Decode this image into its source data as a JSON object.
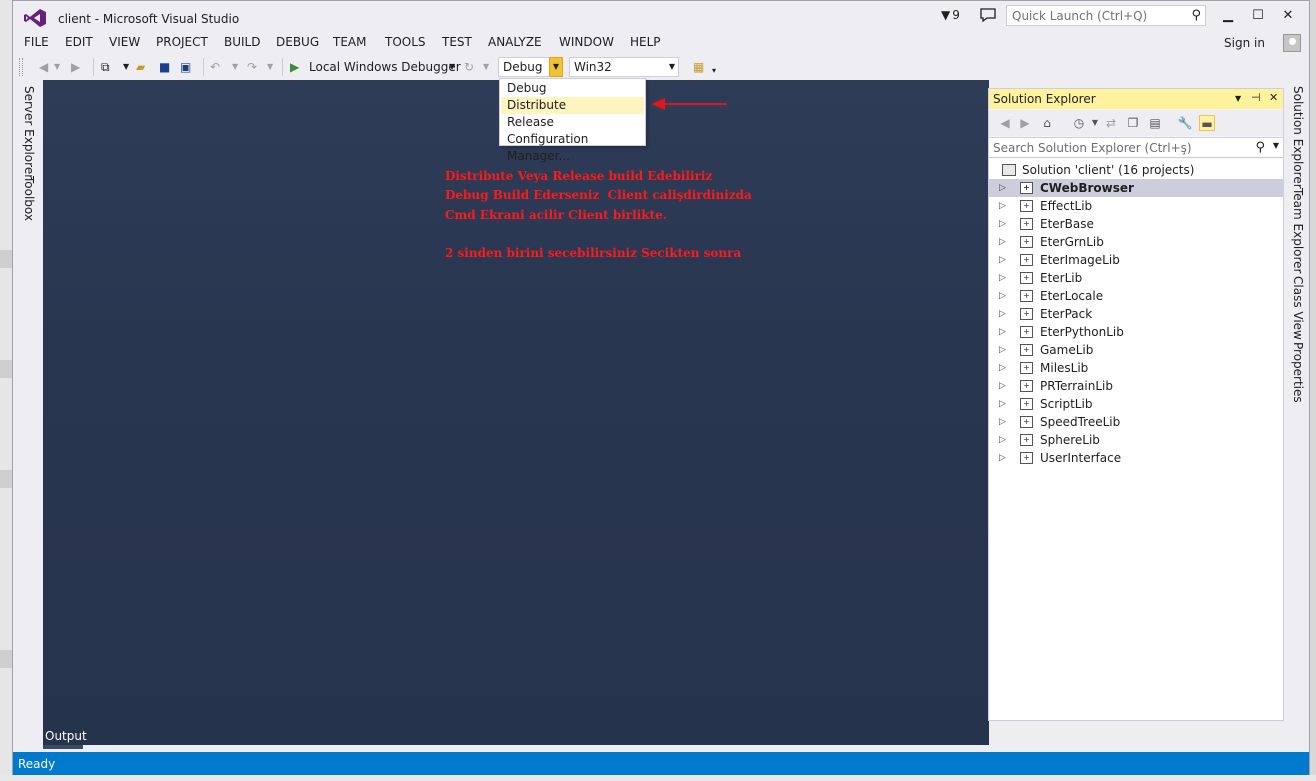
{
  "window": {
    "title": "client - Microsoft Visual Studio",
    "notification_count": "9",
    "quick_launch_placeholder": "Quick Launch (Ctrl+Q)",
    "sign_in": "Sign in"
  },
  "menu": [
    "FILE",
    "EDIT",
    "VIEW",
    "PROJECT",
    "BUILD",
    "DEBUG",
    "TEAM",
    "TOOLS",
    "TEST",
    "ANALYZE",
    "WINDOW",
    "HELP"
  ],
  "toolbar": {
    "debugger_label": "Local Windows Debugger",
    "configuration_value": "Debug",
    "platform_value": "Win32"
  },
  "config_dropdown": {
    "options": [
      "Debug",
      "Distribute",
      "Release",
      "Configuration Manager..."
    ],
    "highlighted": "Distribute"
  },
  "annotation": {
    "lines": [
      "Distribute Veya Release build Edebiliriz",
      "Debug Build Ederseniz  Client calişdirdinizda",
      "Cmd Ekrani acilir Client birlikte.",
      "",
      "2 sinden birini secebilirsiniz Secikten sonra"
    ],
    "color": "#ff1a1a"
  },
  "left_tabs": [
    "Server Explorer",
    "Toolbox"
  ],
  "right_tabs": [
    "Solution Explorer",
    "Team Explorer",
    "Class View",
    "Properties"
  ],
  "solution_explorer": {
    "title": "Solution Explorer",
    "search_placeholder": "Search Solution Explorer (Ctrl+ş)",
    "solution_label": "Solution 'client' (16 projects)",
    "projects": [
      "CWebBrowser",
      "EffectLib",
      "EterBase",
      "EterGrnLib",
      "EterImageLib",
      "EterLib",
      "EterLocale",
      "EterPack",
      "EterPythonLib",
      "GameLib",
      "MilesLib",
      "PRTerrainLib",
      "ScriptLib",
      "SpeedTreeLib",
      "SphereLib",
      "UserInterface"
    ],
    "selected_project": "CWebBrowser"
  },
  "output_tab": "Output",
  "status": "Ready",
  "colors": {
    "accent": "#007acc",
    "editor_background": "#2b3953",
    "solution_explorer_title": "#fff29d",
    "dropdown_highlight": "#fdf4bf"
  }
}
